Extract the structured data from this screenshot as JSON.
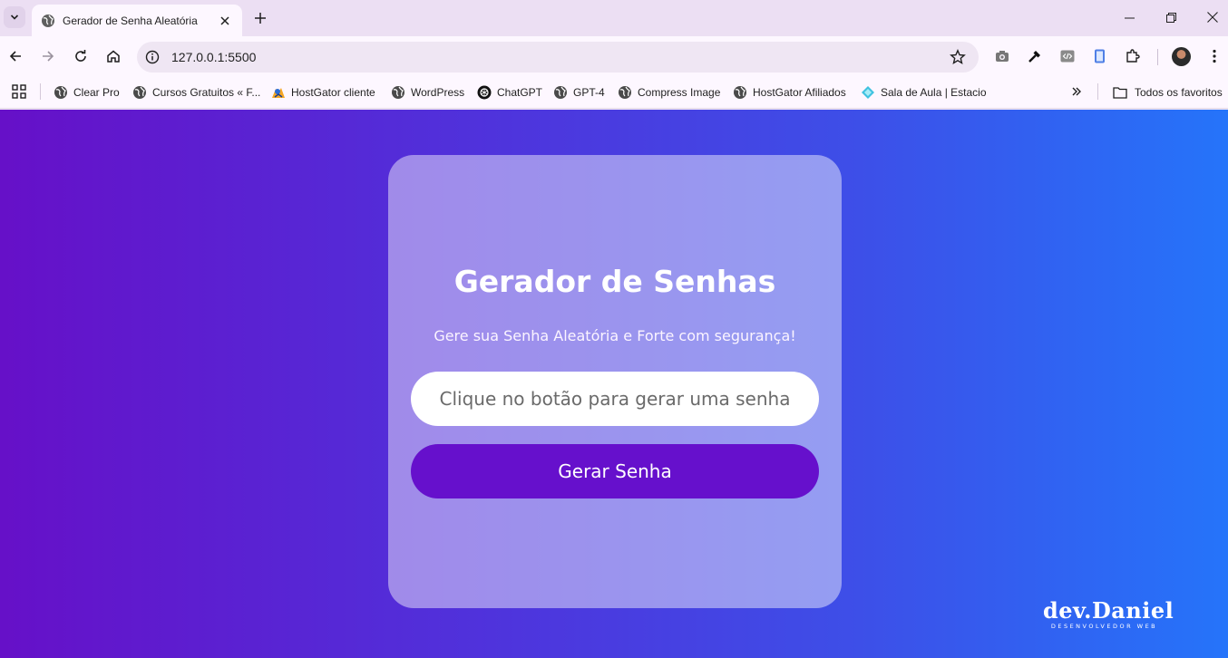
{
  "browser": {
    "tab": {
      "title": "Gerador de Senha Aleatória"
    },
    "address_bar": {
      "url": "127.0.0.1:5500"
    },
    "bookmarks": [
      {
        "label": "Clear Pro",
        "icon": "globe-icon"
      },
      {
        "label": "Cursos Gratuitos « F...",
        "icon": "globe-icon"
      },
      {
        "label": "HostGator cliente",
        "icon": "hostgator-icon"
      },
      {
        "label": "WordPress",
        "icon": "globe-icon"
      },
      {
        "label": "ChatGPT",
        "icon": "chatgpt-icon"
      },
      {
        "label": "GPT-4",
        "icon": "globe-icon"
      },
      {
        "label": "Compress Image",
        "icon": "globe-icon"
      },
      {
        "label": "HostGator Afiliados",
        "icon": "globe-icon"
      },
      {
        "label": "Sala de Aula | Estacio",
        "icon": "diamond-icon"
      }
    ],
    "all_bookmarks_label": "Todos os favoritos"
  },
  "page": {
    "title": "Gerador de Senhas",
    "subtitle": "Gere sua Senha Aleatória e Forte com segurança!",
    "password_field": {
      "placeholder": "Clique no botão para gerar uma senha",
      "value": ""
    },
    "generate_button_label": "Gerar Senha",
    "logo": {
      "name": "dev.Daniel",
      "tagline": "DESENVOLVEDOR WEB"
    }
  },
  "colors": {
    "background_gradient_start": "#6610c8",
    "background_gradient_end": "#2574fa",
    "button": "#6610cc",
    "card": "rgba(255,255,255,0.45)"
  }
}
